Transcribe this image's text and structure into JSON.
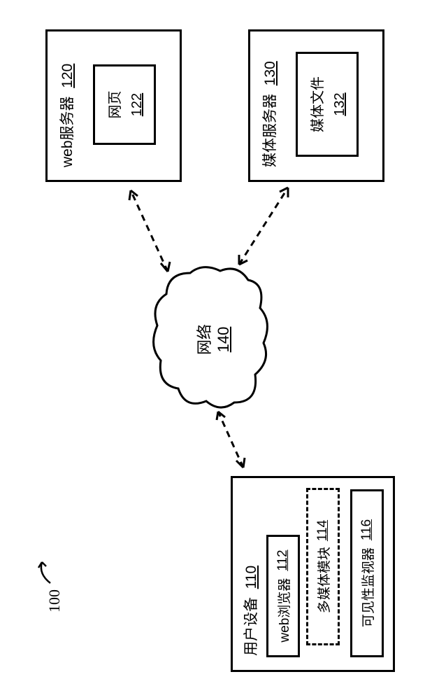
{
  "figure_ref": "100",
  "user_device": {
    "title": "用户设备",
    "ref": "110",
    "browser": {
      "title": "web浏览器",
      "ref": "112"
    },
    "multimedia": {
      "title": "多媒体模块",
      "ref": "114"
    },
    "monitor": {
      "title": "可见性监视器",
      "ref": "116"
    }
  },
  "network": {
    "title": "网络",
    "ref": "140"
  },
  "web_server": {
    "title": "web服务器",
    "ref": "120",
    "page": {
      "title": "网页",
      "ref": "122"
    }
  },
  "media_server": {
    "title": "媒体服务器",
    "ref": "130",
    "file": {
      "title": "媒体文件",
      "ref": "132"
    }
  }
}
